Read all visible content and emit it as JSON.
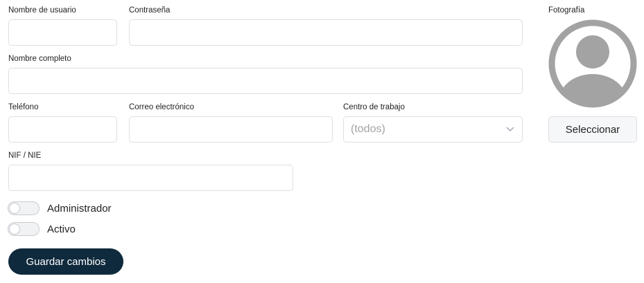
{
  "form": {
    "username_label": "Nombre de usuario",
    "username_value": "",
    "password_label": "Contraseña",
    "password_value": "",
    "fullname_label": "Nombre completo",
    "fullname_value": "",
    "phone_label": "Teléfono",
    "phone_value": "",
    "email_label": "Correo electrónico",
    "email_value": "",
    "workcenter_label": "Centro de trabajo",
    "workcenter_selected": "(todos)",
    "nif_label": "NIF / NIE",
    "nif_value": "",
    "admin_label": "Administrador",
    "admin_checked": false,
    "active_label": "Activo",
    "active_checked": false,
    "save_label": "Guardar cambios"
  },
  "photo": {
    "label": "Fotografía",
    "select_label": "Seleccionar",
    "placeholder_icon": "user-avatar-icon"
  },
  "colors": {
    "primary_button": "#0f2a3d",
    "avatar_gray": "#a3a3a3",
    "border": "#dcdfe4"
  }
}
